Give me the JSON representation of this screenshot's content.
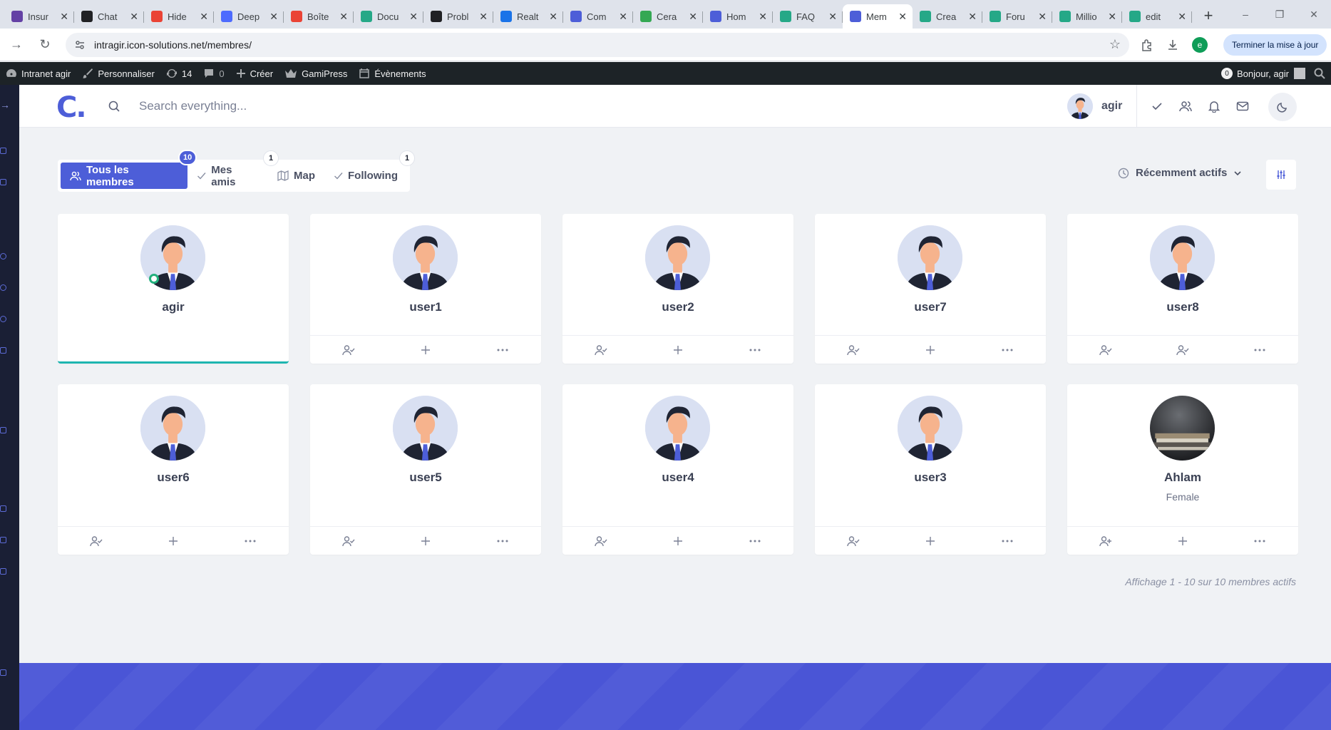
{
  "browser": {
    "tabs": [
      {
        "title": "Insur",
        "icon": "twitch-icon",
        "color": "#6441a5"
      },
      {
        "title": "Chat",
        "icon": "openai-icon",
        "color": "#202124"
      },
      {
        "title": "Hide",
        "icon": "google-icon",
        "color": "#ea4335"
      },
      {
        "title": "Deep",
        "icon": "deepseek-icon",
        "color": "#4d6bfe"
      },
      {
        "title": "Boîte",
        "icon": "gmail-icon",
        "color": "#ea4335"
      },
      {
        "title": "Docu",
        "icon": "buddyboss-icon",
        "color": "#25a887"
      },
      {
        "title": "Probl",
        "icon": "openai-icon",
        "color": "#202124"
      },
      {
        "title": "Realt",
        "icon": "chat-icon",
        "color": "#1a73e8"
      },
      {
        "title": "Com",
        "icon": "community-icon",
        "color": "#4d5ed8"
      },
      {
        "title": "Cera",
        "icon": "cera-icon",
        "color": "#34a853"
      },
      {
        "title": "Hom",
        "icon": "community-icon",
        "color": "#4d5ed8"
      },
      {
        "title": "FAQ",
        "icon": "buddyboss-icon",
        "color": "#25a887"
      },
      {
        "title": "Mem",
        "icon": "community-icon",
        "color": "#4d5ed8",
        "active": true
      },
      {
        "title": "Crea",
        "icon": "buddyboss-icon",
        "color": "#25a887"
      },
      {
        "title": "Foru",
        "icon": "buddyboss-icon",
        "color": "#25a887"
      },
      {
        "title": "Millio",
        "icon": "buddyboss-icon",
        "color": "#25a887"
      },
      {
        "title": "edit",
        "icon": "buddyboss-icon",
        "color": "#25a887"
      }
    ],
    "url": "intragir.icon-solutions.net/membres/",
    "profile_initial": "e",
    "update_label": "Terminer la mise à jour"
  },
  "adminbar": {
    "site": "Intranet agir",
    "customize": "Personnaliser",
    "updates": "14",
    "comments": "0",
    "create": "Créer",
    "gamipress": "GamiPress",
    "events": "Évènements",
    "notif_count": "0",
    "greeting": "Bonjour, agir"
  },
  "header": {
    "logo": "C.",
    "search_placeholder": "Search everything...",
    "username": "agir"
  },
  "filters": {
    "tabs": [
      {
        "label": "Tous les membres",
        "badge": "10",
        "active": true
      },
      {
        "label": "Mes amis",
        "badge": "1"
      },
      {
        "label": "Map",
        "badge": ""
      },
      {
        "label": "Following",
        "badge": "1"
      }
    ],
    "sort_label": "Récemment actifs"
  },
  "members": [
    {
      "name": "agir",
      "subtitle": "",
      "online": true,
      "current": true,
      "photo": false,
      "first_action": "friend-check"
    },
    {
      "name": "user1",
      "subtitle": "",
      "photo": false,
      "first_action": "friend-check"
    },
    {
      "name": "user2",
      "subtitle": "",
      "photo": false,
      "first_action": "friend-check"
    },
    {
      "name": "user7",
      "subtitle": "",
      "photo": false,
      "first_action": "friend-check"
    },
    {
      "name": "user8",
      "subtitle": "",
      "photo": false,
      "first_action": "friend-check",
      "second_action": "friend-check"
    },
    {
      "name": "user6",
      "subtitle": "",
      "photo": false,
      "first_action": "friend-check"
    },
    {
      "name": "user5",
      "subtitle": "",
      "photo": false,
      "first_action": "friend-check"
    },
    {
      "name": "user4",
      "subtitle": "",
      "photo": false,
      "first_action": "friend-check"
    },
    {
      "name": "user3",
      "subtitle": "",
      "photo": false,
      "first_action": "friend-check"
    },
    {
      "name": "Ahlam",
      "subtitle": "Female",
      "photo": true,
      "first_action": "add-friend"
    }
  ],
  "pagination": "Affichage 1 - 10 sur 10 membres actifs",
  "colors": {
    "primary": "#4d5ed8",
    "online": "#22b07d",
    "accent_line": "#1eb5b0",
    "footer": "#4a55d6"
  }
}
